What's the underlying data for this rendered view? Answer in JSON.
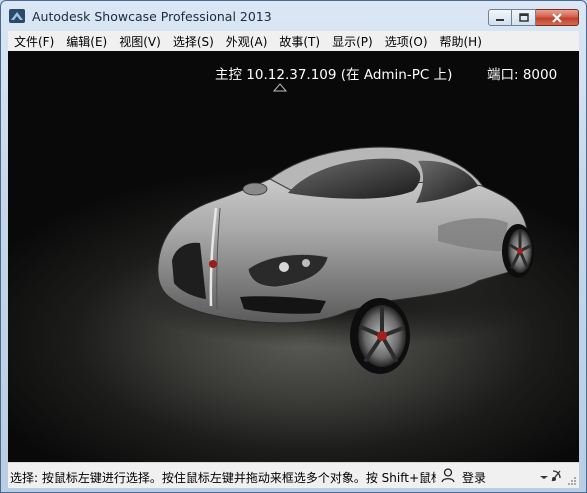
{
  "window": {
    "title": "Autodesk Showcase Professional 2013"
  },
  "menu": [
    {
      "label": "文件(F)"
    },
    {
      "label": "编辑(E)"
    },
    {
      "label": "视图(V)"
    },
    {
      "label": "选择(S)"
    },
    {
      "label": "外观(A)"
    },
    {
      "label": "故事(T)"
    },
    {
      "label": "显示(P)"
    },
    {
      "label": "选项(O)"
    },
    {
      "label": "帮助(H)"
    }
  ],
  "viewport": {
    "host": "主控 10.12.37.109 (在 Admin-PC 上)",
    "port": "端口: 8000"
  },
  "status": {
    "text": "选择: 按鼠标左键进行选择。按住鼠标左键并拖动来框选多个对象。按 Shift+鼠标",
    "login": "登录"
  }
}
